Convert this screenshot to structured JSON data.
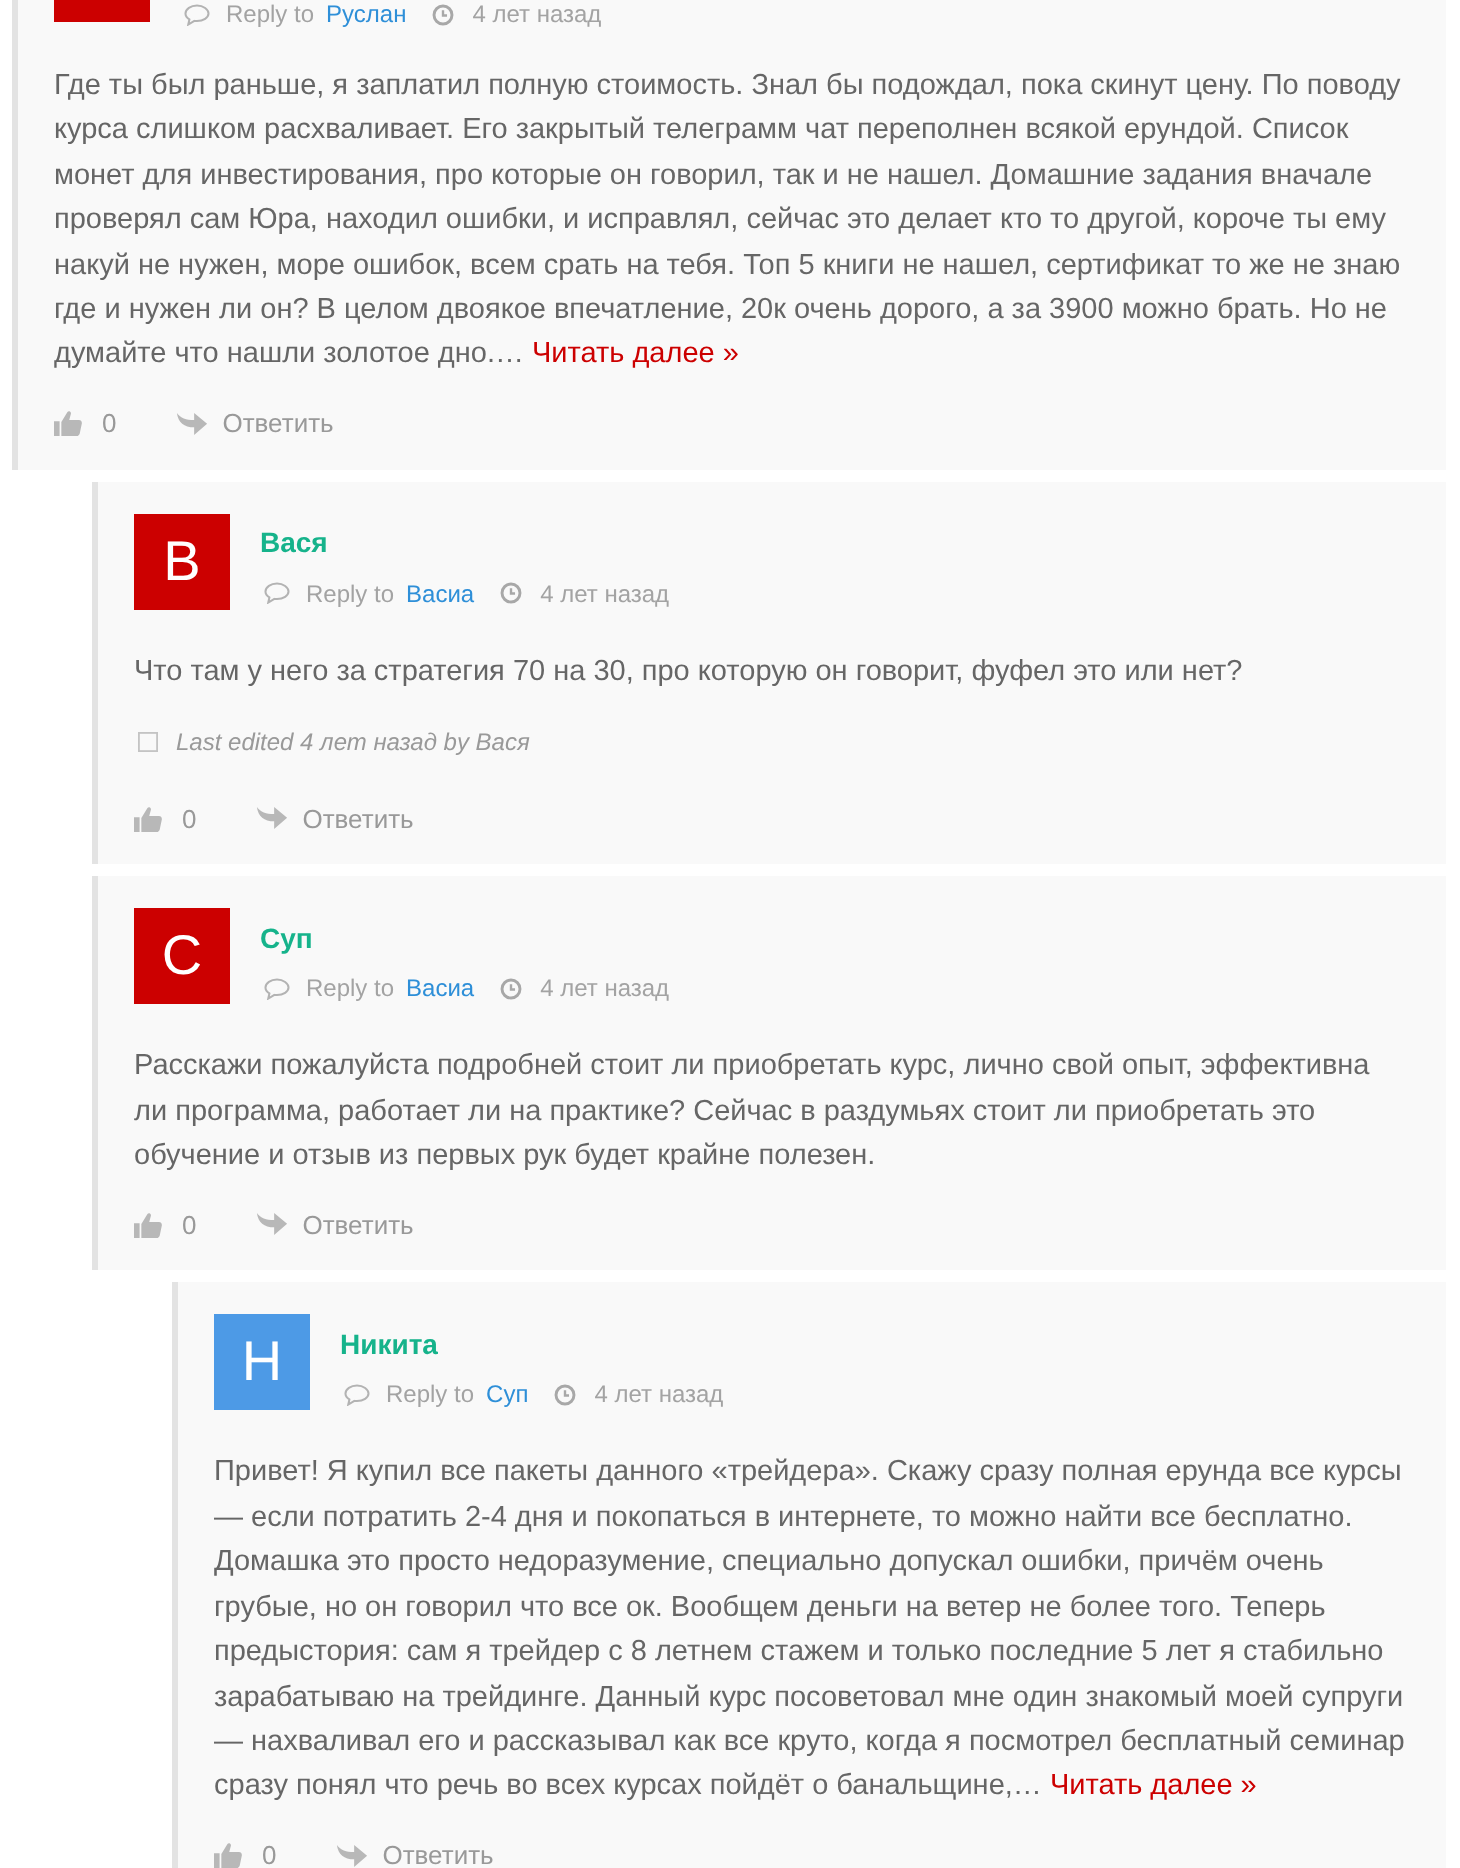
{
  "comments": [
    {
      "avatar": {
        "color": "#cc0000"
      },
      "reply_to": {
        "label": "Reply to",
        "name": "Руслан"
      },
      "time": "4 лет назад",
      "text": "Где ты был раньше, я заплатил полную стоимость. Знал бы подождал, пока скинут цену. По поводу курса слишком расхваливает. Его закрытый телеграмм чат переполнен всякой ерундой. Список монет для инвестирования, про которые он говорил, так и не нашел. Домашние задания вначале проверял сам Юра, находил ошибки, и исправлял, сейчас это делает кто то другой, короче ты ему накуй не нужен, море ошибок, всем срать на тебя. Топ 5 книги не нашел, сертификат то же не знаю где и нужен ли он? В целом двоякое впечатление, 20к очень дорого, а за 3900 можно брать. Но не думайте что нашли золотое дно.…",
      "read_more": "Читать далее »",
      "likes": "0",
      "reply_label": "Ответить",
      "children": [
        {
          "author": "Вася",
          "avatar": {
            "letter": "В",
            "color": "#cc0000"
          },
          "reply_to": {
            "label": "Reply to",
            "name": "Васиа"
          },
          "time": "4 лет назад",
          "text": "Что там у него за стратегия 70 на 30, про которую он говорит, фуфел это или нет?",
          "edited": "Last edited 4 лет назад by Вася",
          "likes": "0",
          "reply_label": "Ответить"
        },
        {
          "author": "Суп",
          "avatar": {
            "letter": "С",
            "color": "#cc0000"
          },
          "reply_to": {
            "label": "Reply to",
            "name": "Васиа"
          },
          "time": "4 лет назад",
          "text": "Расскажи пожалуйста подробней стоит ли приобретать курс, лично свой опыт, эффективна ли программа, работает ли на практике? Сейчас в раздумьях стоит ли приобретать это обучение и отзыв из первых рук будет крайне полезен.",
          "likes": "0",
          "reply_label": "Ответить",
          "children": [
            {
              "author": "Никита",
              "avatar": {
                "letter": "Н",
                "color": "#4d9ae6"
              },
              "reply_to": {
                "label": "Reply to",
                "name": "Суп"
              },
              "time": "4 лет назад",
              "text": "Привет! Я купил все пакеты данного «трейдера». Скажу сразу полная ерунда все курсы — если потратить 2-4 дня и покопаться в интернете, то можно найти все бесплатно. Домашка это просто недоразумение, специально допускал ошибки, причём очень грубые, но он говорил что все ок. Вообщем деньги на ветер не более того. Теперь предыстория: сам я трейдер с 8 летнем стажем и только последние 5 лет я стабильно зарабатываю на трейдинге. Данный курс посоветовал мне один знакомый моей супруги — нахваливал его и рассказывал как все круто, когда я посмотрел бесплатный семинар сразу понял что речь во всех курсах пойдёт о банальщине,…",
              "read_more": "Читать далее »",
              "likes": "0",
              "reply_label": "Ответить"
            }
          ]
        }
      ]
    }
  ]
}
